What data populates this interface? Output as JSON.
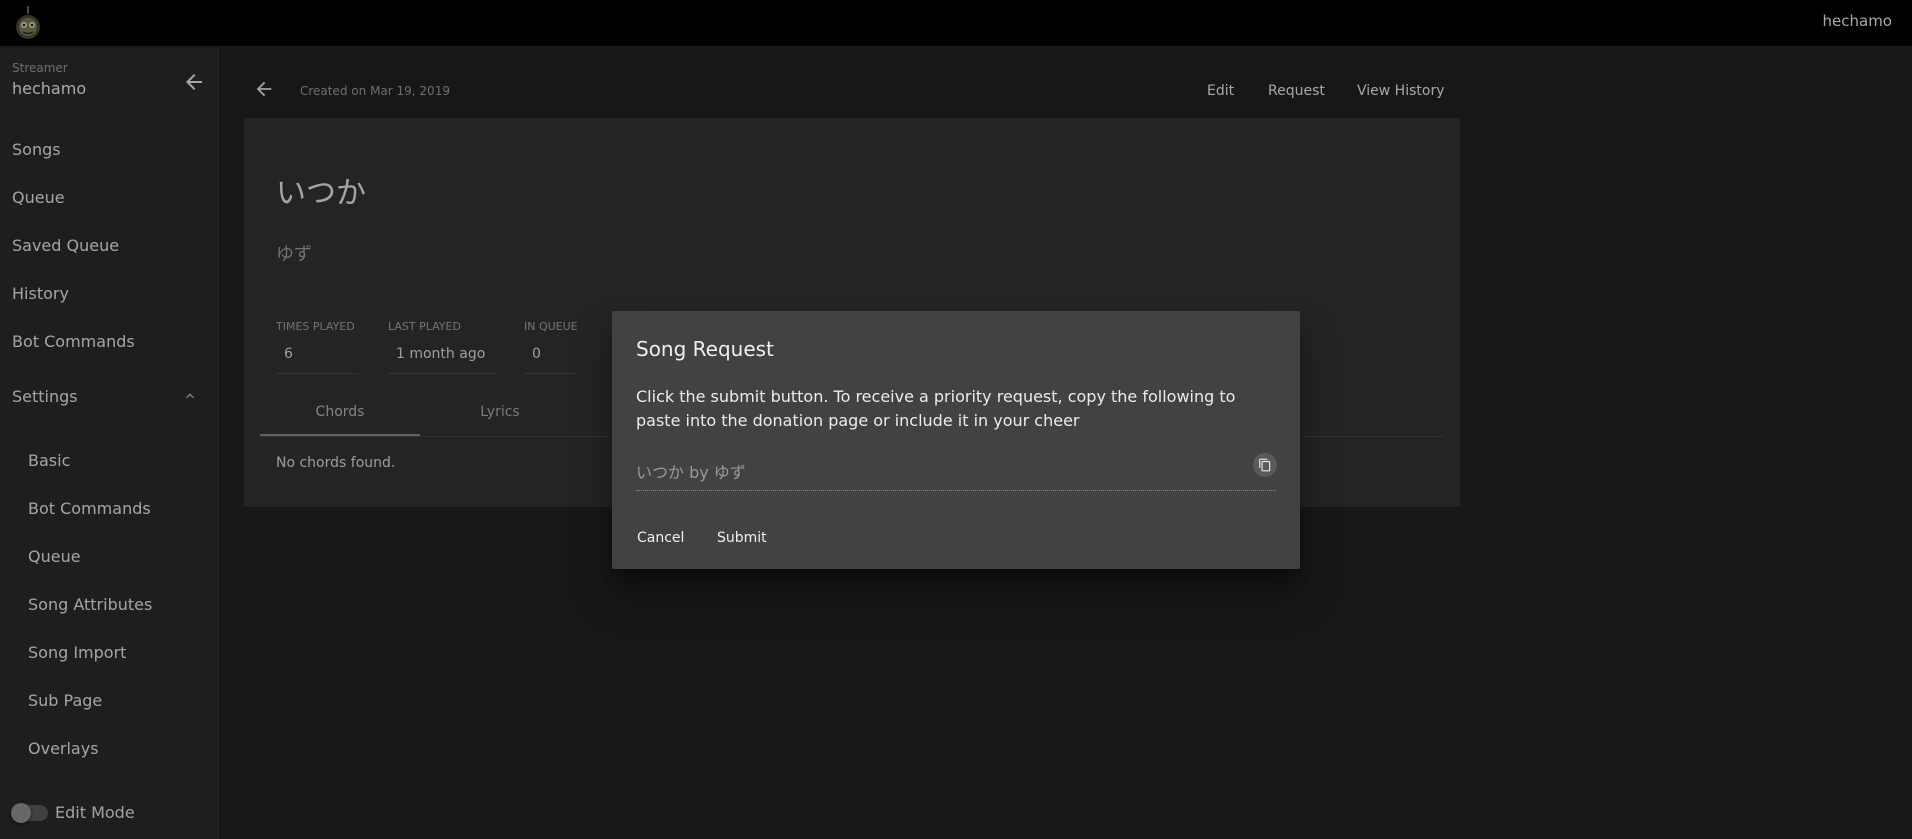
{
  "topbar": {
    "logo_icon": "app-logo-icon",
    "username": "hechamo"
  },
  "sidebar": {
    "streamer_caption": "Streamer",
    "streamer_name": "hechamo",
    "collapse_icon": "arrow-left-icon",
    "items": [
      {
        "label": "Songs"
      },
      {
        "label": "Queue"
      },
      {
        "label": "Saved Queue"
      },
      {
        "label": "History"
      },
      {
        "label": "Bot Commands"
      }
    ],
    "settings": {
      "label": "Settings",
      "expanded": true,
      "icon": "chevron-up-icon",
      "items": [
        {
          "label": "Basic"
        },
        {
          "label": "Bot Commands"
        },
        {
          "label": "Queue"
        },
        {
          "label": "Song Attributes"
        },
        {
          "label": "Song Import"
        },
        {
          "label": "Sub Page"
        },
        {
          "label": "Overlays"
        }
      ]
    },
    "edit_mode": {
      "label": "Edit Mode",
      "enabled": false
    }
  },
  "header": {
    "back_icon": "arrow-left-icon",
    "created_on": "Created on Mar 19, 2019",
    "actions": [
      {
        "label": "Edit"
      },
      {
        "label": "Request"
      },
      {
        "label": "View History"
      }
    ]
  },
  "song": {
    "title": "いつか",
    "artist": "ゆず",
    "stats": [
      {
        "label": "TIMES PLAYED",
        "value": "6"
      },
      {
        "label": "LAST PLAYED",
        "value": "1 month ago"
      },
      {
        "label": "IN QUEUE",
        "value": "0"
      }
    ],
    "tabs": [
      {
        "label": "Chords",
        "active": true
      },
      {
        "label": "Lyrics",
        "active": false
      }
    ],
    "empty_message": "No chords found."
  },
  "dialog": {
    "title": "Song Request",
    "text": "Click the submit button. To receive a priority request, copy the following to paste into the donation page or include it in your cheer",
    "copy_value": "いつか by ゆず",
    "copy_icon": "copy-icon",
    "cancel_label": "Cancel",
    "submit_label": "Submit"
  },
  "colors": {
    "background": "#202020",
    "sidebar": "#2a2a2a",
    "card": "#333333",
    "dialog": "#424242",
    "topbar": "#000000"
  }
}
